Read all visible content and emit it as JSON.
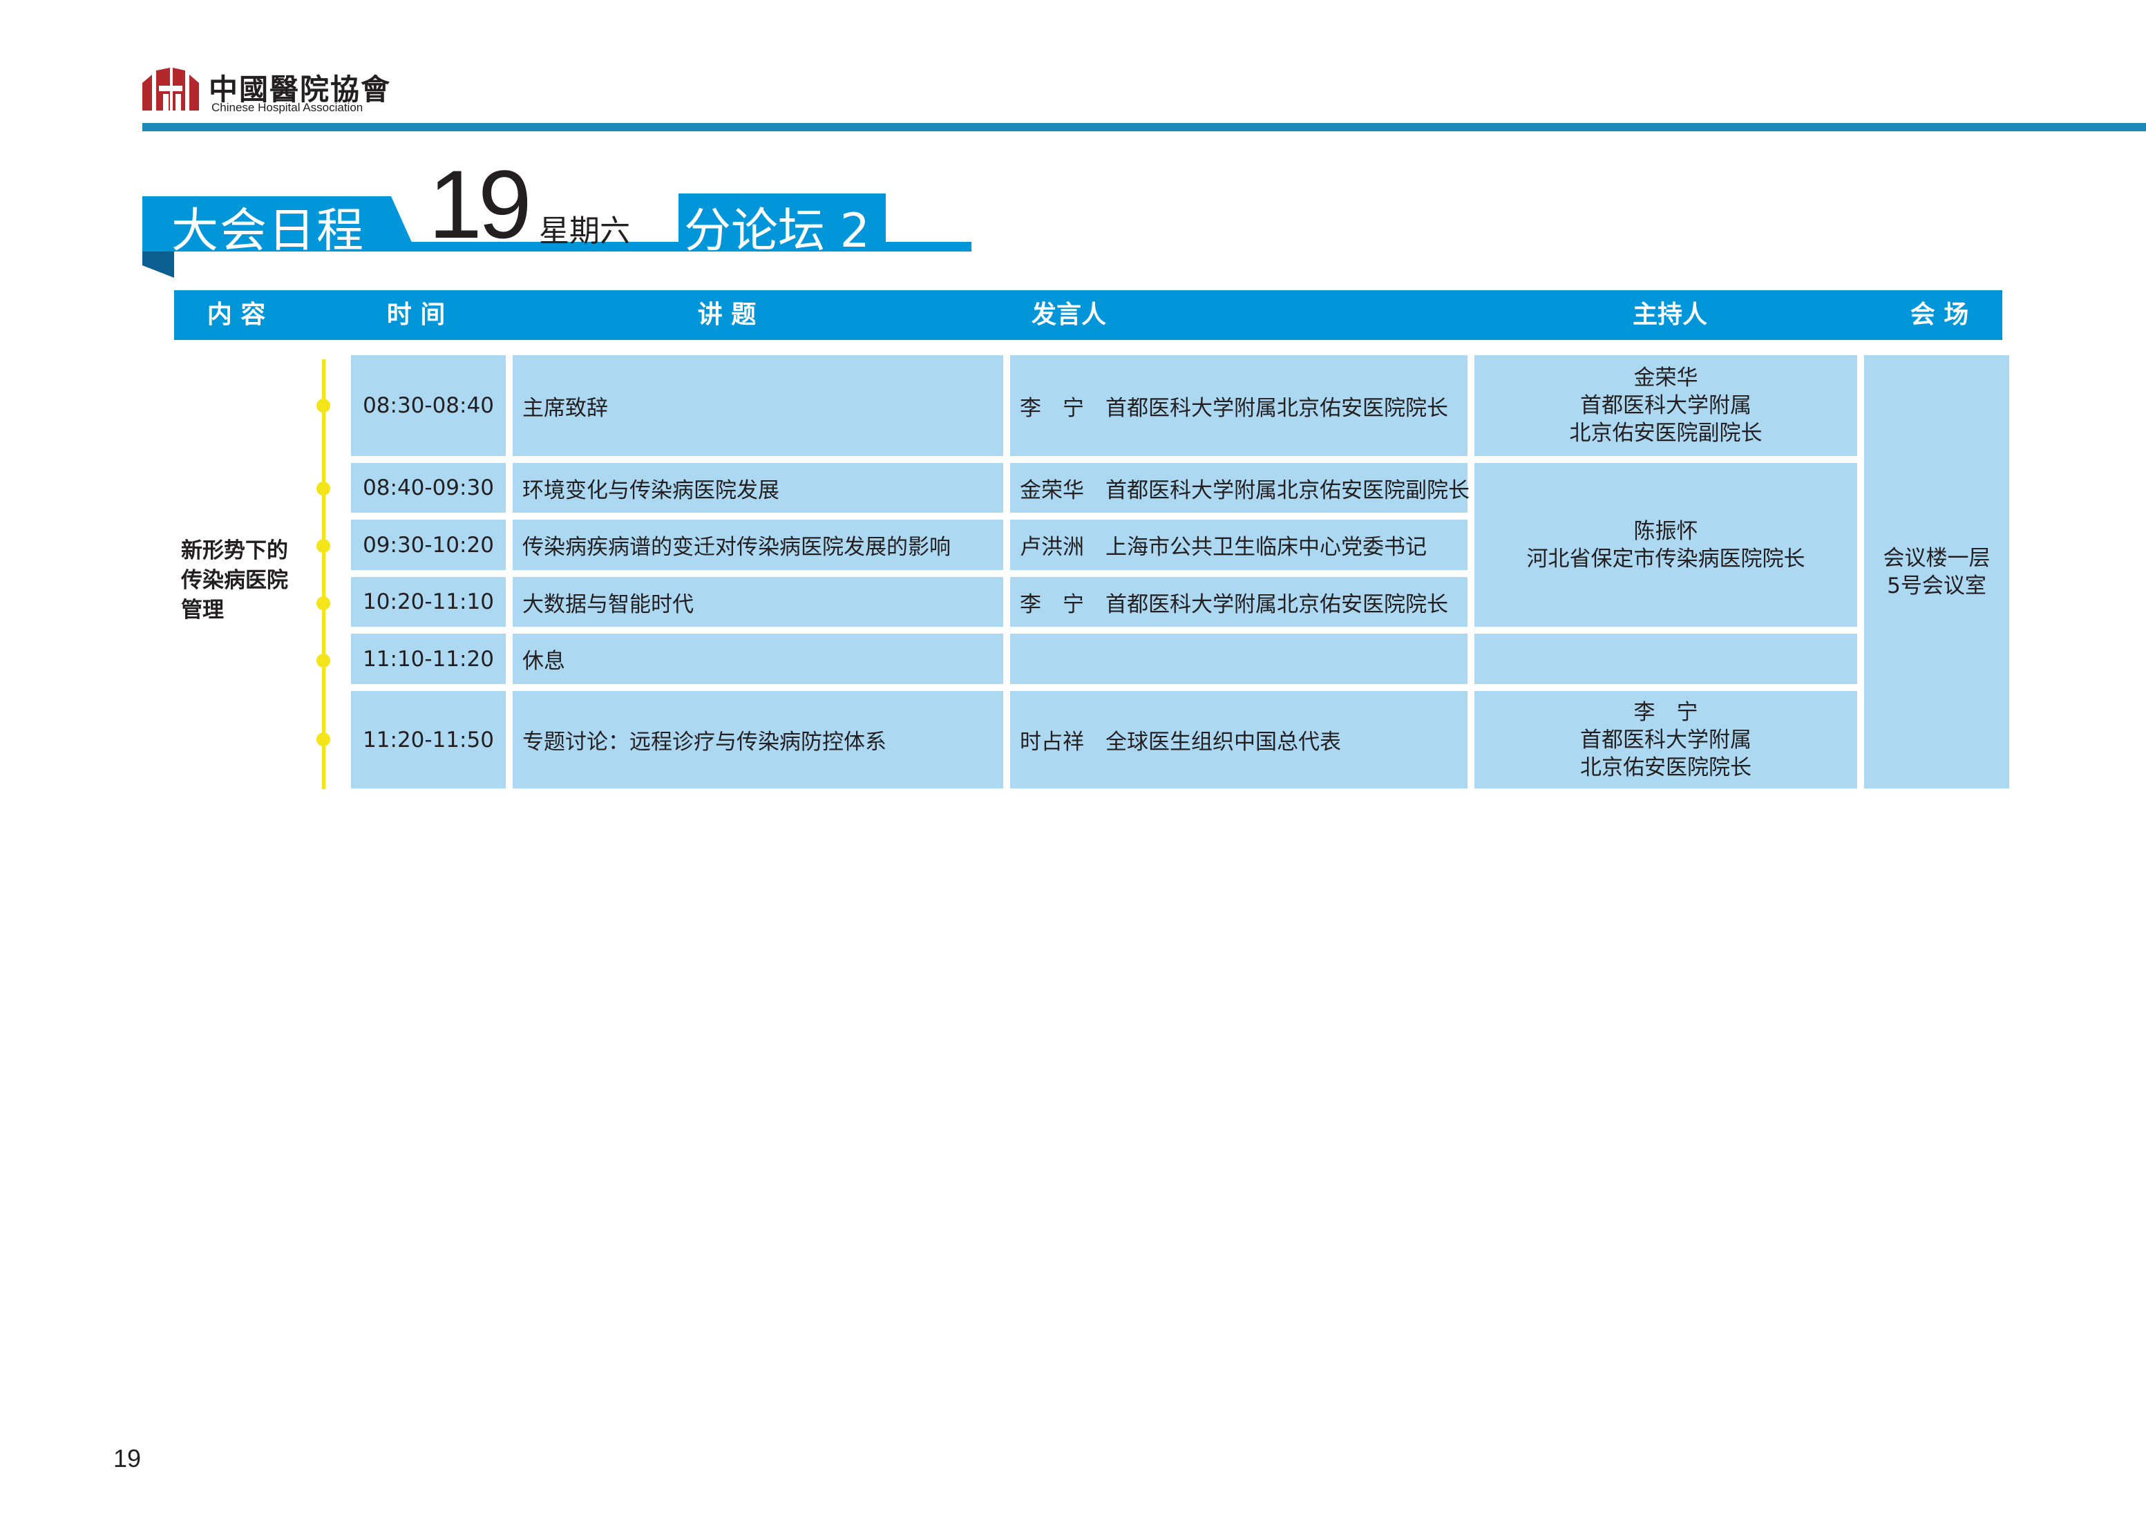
{
  "header": {
    "org_name_cn": "中國醫院協會",
    "org_name_en": "Chinese Hospital Association"
  },
  "title": {
    "main": "大会日程",
    "day": "19",
    "weekday": "星期六",
    "forum": "分论坛 2"
  },
  "columns": [
    "内 容",
    "时 间",
    "讲 题",
    "发言人",
    "主持人",
    "会 场"
  ],
  "section_label": "新形势下的传染病医院管理",
  "rows": [
    {
      "time": "08:30-08:40",
      "topic": "主席致辞",
      "speaker": "李　宁　首都医科大学附属北京佑安医院院长"
    },
    {
      "time": "08:40-09:30",
      "topic": "环境变化与传染病医院发展",
      "speaker": "金荣华　首都医科大学附属北京佑安医院副院长"
    },
    {
      "time": "09:30-10:20",
      "topic": "传染病疾病谱的变迁对传染病医院发展的影响",
      "speaker": "卢洪洲　上海市公共卫生临床中心党委书记"
    },
    {
      "time": "10:20-11:10",
      "topic": "大数据与智能时代",
      "speaker": "李　宁　首都医科大学附属北京佑安医院院长"
    },
    {
      "time": "11:10-11:20",
      "topic": "休息",
      "speaker": ""
    },
    {
      "time": "11:20-11:50",
      "topic": "专题讨论：远程诊疗与传染病防控体系",
      "speaker": "时占祥　全球医生组织中国总代表"
    }
  ],
  "hosts": [
    {
      "lines": [
        "金荣华",
        "首都医科大学附属",
        "北京佑安医院副院长"
      ]
    },
    {
      "lines": [
        "陈振怀",
        "河北省保定市传染病医院院长"
      ]
    },
    {
      "lines": []
    },
    {
      "lines": [
        "李　宁",
        "首都医科大学附属",
        "北京佑安医院院长"
      ]
    }
  ],
  "venue": {
    "lines": [
      "会议楼一层",
      "5号会议室"
    ]
  },
  "page_number": "19",
  "colors": {
    "header_blue": "#0096d9",
    "rule_blue": "#1e88b7",
    "cell_blue": "#add8f1",
    "timeline_yellow": "#f4e51b",
    "logo_red": "#b3282d"
  }
}
